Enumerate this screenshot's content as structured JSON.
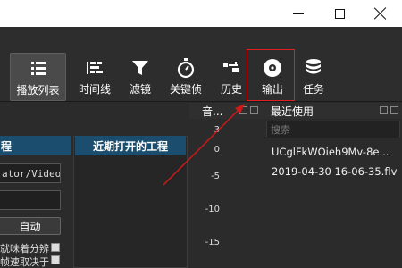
{
  "window": {
    "controls": [
      "minimize",
      "maximize",
      "close"
    ]
  },
  "toolbar": {
    "items": [
      {
        "label": "播放列表",
        "icon": "playlist-icon",
        "active": true
      },
      {
        "label": "时间线",
        "icon": "timeline-icon",
        "active": false
      },
      {
        "label": "滤镜",
        "icon": "filter-icon",
        "active": false
      },
      {
        "label": "关键侦",
        "icon": "keyframe-stopwatch-icon",
        "active": false
      },
      {
        "label": "历史",
        "icon": "history-icon",
        "active": false
      },
      {
        "label": "输出",
        "icon": "export-disc-icon",
        "active": false
      },
      {
        "label": "任务",
        "icon": "jobs-stack-icon",
        "active": false
      }
    ],
    "highlight_color": "#e02020"
  },
  "left_panel": {
    "header": "程",
    "path_value": "ator/Videos",
    "auto_button": "自动",
    "option_lines": [
      "就味着分辨",
      "帧速取决于"
    ]
  },
  "recent_projects": {
    "header": "近期打开的工程"
  },
  "audio_meter": {
    "title": "音...",
    "ticks": [
      "3",
      "0",
      "-5",
      "-10",
      "-15"
    ]
  },
  "recent_files": {
    "title": "最近使用",
    "search_placeholder": "搜索",
    "items": [
      "UCglFkWOieh9Mv-8e...",
      "2019-04-30 16-06-35.flv"
    ]
  },
  "colors": {
    "accent_header": "#1b4e6e",
    "toolbar_bg": "#2d2d2d",
    "panel_bg": "#2b2b2b"
  }
}
